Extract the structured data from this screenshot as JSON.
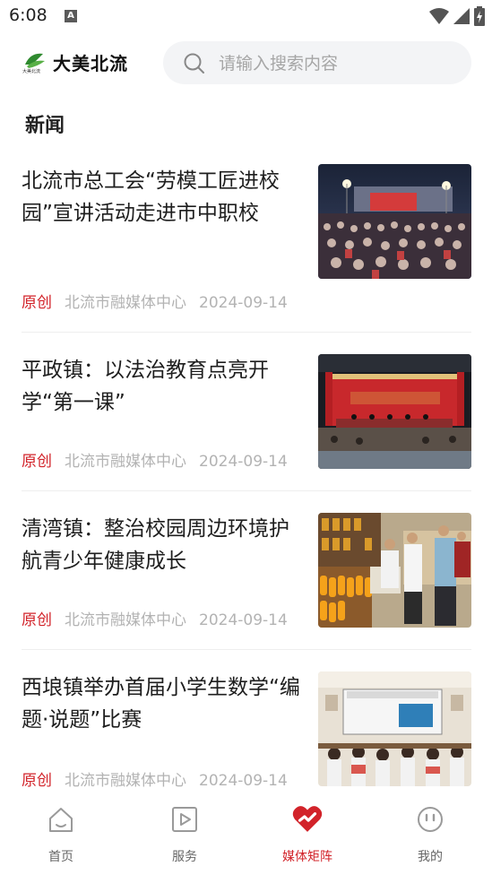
{
  "status_bar": {
    "time": "6:08",
    "notification_icon": "A"
  },
  "header": {
    "app_title": "大美北流",
    "logo_icon": "logo-leaf-icon",
    "search_placeholder": "请输入搜索内容"
  },
  "section": {
    "title": "新闻"
  },
  "news": [
    {
      "title": "北流市总工会“劳模工匠进校园”宣讲活动走进市中职校",
      "tag": "原创",
      "source": "北流市融媒体中心",
      "date": "2024-09-14"
    },
    {
      "title": "平政镇：以法治教育点亮开学“第一课”",
      "tag": "原创",
      "source": "北流市融媒体中心",
      "date": "2024-09-14"
    },
    {
      "title": "清湾镇：整治校园周边环境护航青少年健康成长",
      "tag": "原创",
      "source": "北流市融媒体中心",
      "date": "2024-09-14"
    },
    {
      "title": "西埌镇举办首届小学生数学“编题·说题”比赛",
      "tag": "原创",
      "source": "北流市融媒体中心",
      "date": "2024-09-14"
    }
  ],
  "tabbar": {
    "items": [
      {
        "label": "首页",
        "icon": "home-icon"
      },
      {
        "label": "服务",
        "icon": "play-icon"
      },
      {
        "label": "媒体矩阵",
        "icon": "heart-icon"
      },
      {
        "label": "我的",
        "icon": "smiley-icon"
      }
    ],
    "active_index": 2,
    "active_color": "#d2232a"
  }
}
